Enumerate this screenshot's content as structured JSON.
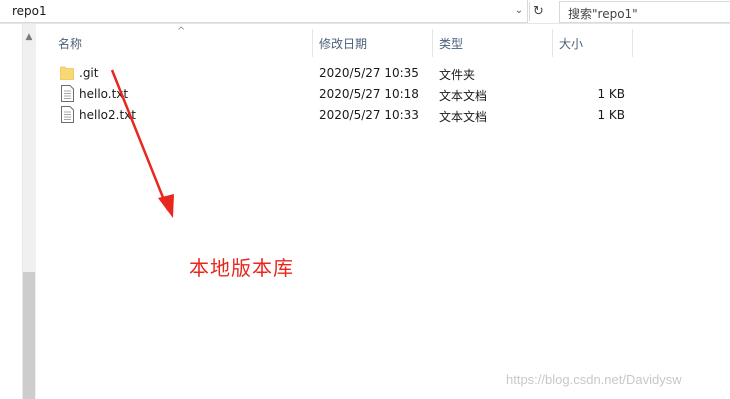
{
  "address_bar": {
    "path": "repo1",
    "dropdown_glyph": "⌄",
    "refresh_glyph": "↻"
  },
  "search": {
    "placeholder": "搜索\"repo1\""
  },
  "columns": {
    "name": "名称",
    "modified": "修改日期",
    "type": "类型",
    "size": "大小",
    "sort_glyph": "^"
  },
  "files": [
    {
      "name": ".git",
      "modified": "2020/5/27 10:35",
      "type": "文件夹",
      "size": "",
      "icon": "folder-icon"
    },
    {
      "name": "hello.txt",
      "modified": "2020/5/27 10:18",
      "type": "文本文档",
      "size": "1 KB",
      "icon": "text-file-icon"
    },
    {
      "name": "hello2.txt",
      "modified": "2020/5/27 10:33",
      "type": "文本文档",
      "size": "1 KB",
      "icon": "text-file-icon"
    }
  ],
  "annotation": {
    "label": "本地版本库",
    "color": "#e8281e"
  },
  "watermark": "https://blog.csdn.net/Davidysw",
  "colors": {
    "header_text": "#4c607a",
    "folder": "#f8d775"
  }
}
